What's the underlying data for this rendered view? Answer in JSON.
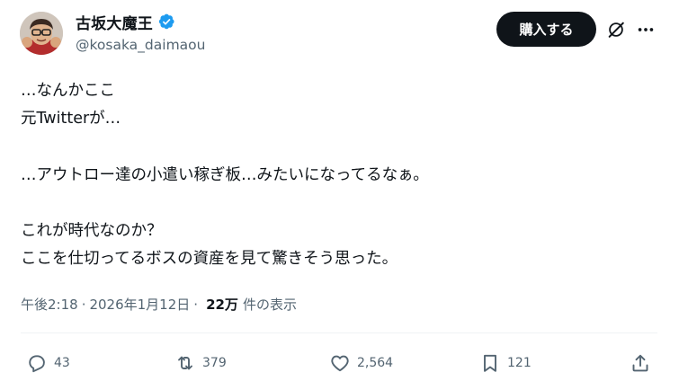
{
  "author": {
    "name": "古坂大魔王",
    "handle": "@kosaka_daimaou",
    "verified": true
  },
  "header": {
    "buy_label": "購入する",
    "grok_icon": "grok-slash-icon",
    "more_icon": "more-dots-icon"
  },
  "tweet": {
    "text": "…なんかここ\n元Twitterが…\n\n…アウトロー達の小遣い稼ぎ板…みたいになってるなぁ。\n\nこれが時代なのか？\nここを仕切ってるボスの資産を見て驚きそう思った。"
  },
  "meta": {
    "time": "午後2:18",
    "separator": "·",
    "date": "2026年1月12日",
    "views_count": "22万",
    "views_label": "件の表示"
  },
  "actions": {
    "replies": "43",
    "reposts": "379",
    "likes": "2,564",
    "bookmarks": "121"
  },
  "colors": {
    "text": "#0f1419",
    "secondary": "#536471",
    "verified": "#1d9bf0",
    "divider": "#eff3f4"
  }
}
